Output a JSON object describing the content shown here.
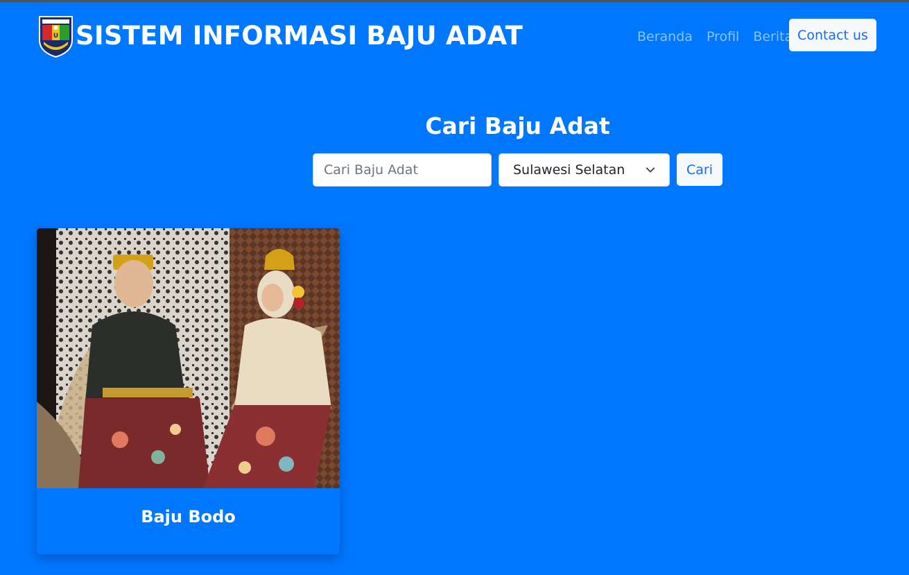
{
  "navbar": {
    "brand_title": "SISTEM INFORMASI BAJU ADAT",
    "logo_icon": "university-shield-logo",
    "links": [
      "Beranda",
      "Profil",
      "Berita"
    ],
    "contact_label": "Contact us"
  },
  "search": {
    "title": "Cari Baju Adat",
    "input_placeholder": "Cari Baju Adat",
    "input_value": "",
    "province_selected": "Sulawesi Selatan",
    "button_label": "Cari"
  },
  "results": [
    {
      "title": "Baju Bodo",
      "image_icon": "traditional-couple-photo"
    }
  ],
  "colors": {
    "background": "#0077ff",
    "button_bg": "#f8f9fa",
    "button_text": "#0d6efd",
    "nav_link": "rgba(255,255,255,0.55)"
  }
}
